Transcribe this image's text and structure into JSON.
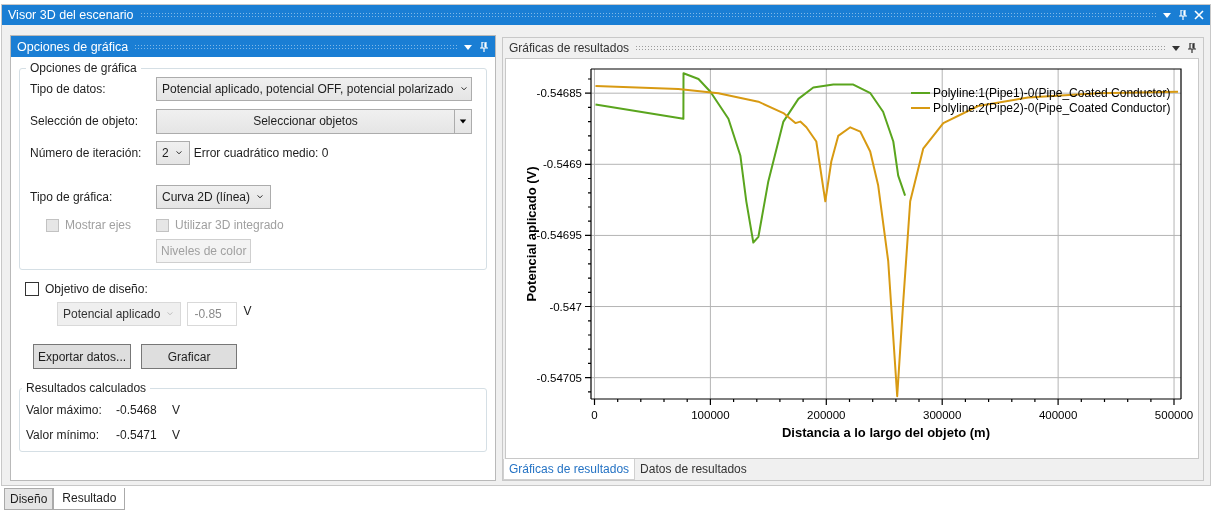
{
  "window": {
    "title": "Visor 3D del escenario"
  },
  "options_panel": {
    "title": "Opciones de gráfica",
    "group": {
      "title": "Opciones de gráfica",
      "data_type": {
        "label": "Tipo de datos:",
        "value": "Potencial aplicado, potencial OFF, potencial polarizado"
      },
      "object_selection": {
        "label": "Selección de objeto:",
        "button": "Seleccionar objetos"
      },
      "iteration": {
        "label": "Número de iteración:",
        "value": "2",
        "error": "Error cuadrático medio: 0"
      },
      "chart_type": {
        "label": "Tipo de gráfica:",
        "value": "Curva 2D (línea)"
      },
      "checkboxes": [
        {
          "label": "Mostrar ejes",
          "checked": false,
          "disabled": true
        },
        {
          "label": "Utilizar 3D integrado",
          "checked": false,
          "disabled": true
        }
      ],
      "color_levels": {
        "label": "Niveles de color",
        "disabled": true
      }
    },
    "design_objective": {
      "label": "Objetivo de diseño:",
      "checked": false,
      "disabled": true,
      "type": "Potencial aplicado",
      "value": "-0.85",
      "unit": "V"
    },
    "buttons": [
      "Exportar datos...",
      "Graficar"
    ],
    "results": {
      "title": "Resultados calculados",
      "rows": [
        {
          "label": "Valor máximo:",
          "value": "-0.5468",
          "unit": "V"
        },
        {
          "label": "Valor mínimo:",
          "value": "-0.5471",
          "unit": "V"
        }
      ]
    }
  },
  "results_panel": {
    "title": "Gráficas de resultados",
    "chart_data": {
      "type": "line",
      "grid": true,
      "legend": true,
      "xlabel": "Distancia a lo largo del objeto (m)",
      "ylabel": "Potencial aplicado (V)",
      "xlim": [
        -3000,
        506000
      ],
      "ylim": [
        -0.547065,
        -0.546833
      ],
      "xticks": [
        0,
        100000,
        200000,
        300000,
        400000,
        500000
      ],
      "yticks": [
        {
          "value": -0.54685,
          "label": "-0.54685"
        },
        {
          "value": -0.5469,
          "label": "-0.5469"
        },
        {
          "value": -0.54695,
          "label": "-0.54695"
        },
        {
          "value": -0.547,
          "label": "-0.547"
        },
        {
          "value": -0.54705,
          "label": "-0.54705"
        }
      ],
      "series": [
        {
          "name": "Polyline:1(Pipe1)-0(Pipe_Coated Conductor)",
          "color": "#5aa51e",
          "x": [
            900,
            76700,
            76800,
            89700,
            100000,
            115500,
            125900,
            131000,
            137000,
            141400,
            150000,
            163000,
            175900,
            188800,
            206000,
            223300,
            238000,
            249000,
            257800,
            262000,
            268000
          ],
          "values": [
            -0.546858,
            -0.546868,
            -0.546836,
            -0.54684,
            -0.546849,
            -0.546868,
            -0.546894,
            -0.546926,
            -0.546955,
            -0.546951,
            -0.546912,
            -0.54687,
            -0.546854,
            -0.546846,
            -0.546844,
            -0.546844,
            -0.54685,
            -0.546863,
            -0.546884,
            -0.546908,
            -0.546922
          ]
        },
        {
          "name": "Polyline:2(Pipe2)-0(Pipe_Coated Conductor)",
          "color": "#d89a12",
          "x": [
            900,
            72400,
            106900,
            141400,
            163000,
            173300,
            177600,
            182800,
            191400,
            199100,
            204300,
            210300,
            220700,
            229300,
            237900,
            244800,
            253400,
            261200,
            266400,
            272400,
            283600,
            300900,
            331000,
            374100,
            434500,
            503400
          ],
          "values": [
            -0.546845,
            -0.546847,
            -0.54685,
            -0.546856,
            -0.546864,
            -0.546871,
            -0.54687,
            -0.546874,
            -0.546884,
            -0.546926,
            -0.546898,
            -0.54688,
            -0.546874,
            -0.546877,
            -0.546891,
            -0.546915,
            -0.546968,
            -0.547063,
            -0.546996,
            -0.546926,
            -0.546889,
            -0.546871,
            -0.546859,
            -0.546853,
            -0.54685,
            -0.546849
          ]
        }
      ]
    },
    "tabs": [
      {
        "label": "Gráficas de resultados",
        "selected": true
      },
      {
        "label": "Datos de resultados",
        "selected": false
      }
    ]
  },
  "bottom_tabs": [
    {
      "label": "Diseño",
      "selected": false
    },
    {
      "label": "Resultado",
      "selected": true
    }
  ]
}
